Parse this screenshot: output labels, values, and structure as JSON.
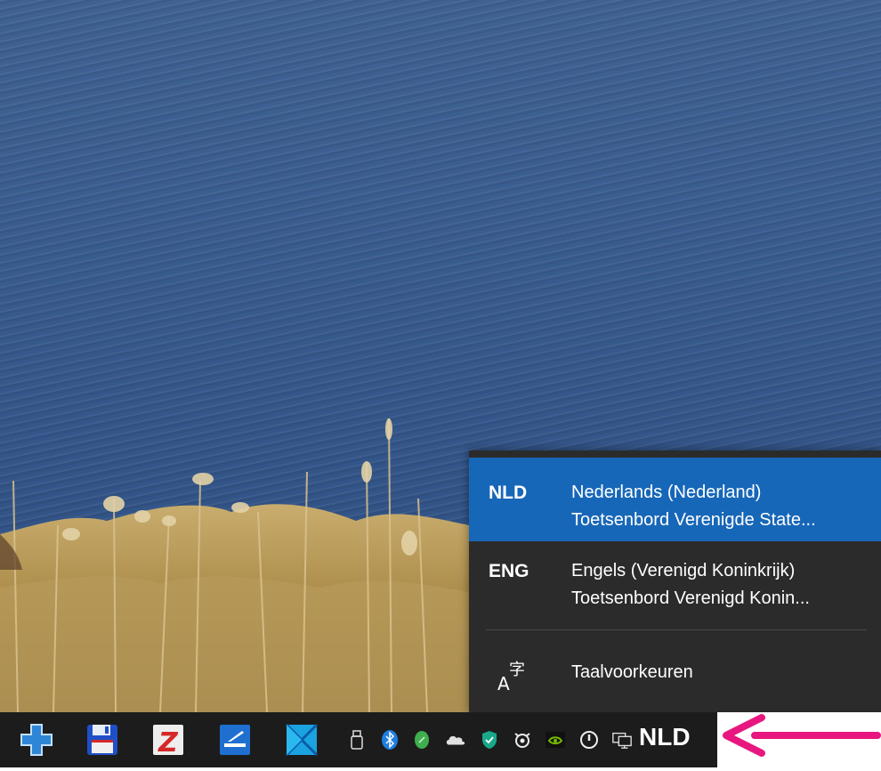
{
  "flyout": {
    "languages": [
      {
        "code": "NLD",
        "name": "Nederlands (Nederland)",
        "keyboard": "Toetsenbord Verenigde State...",
        "selected": true
      },
      {
        "code": "ENG",
        "name": "Engels (Verenigd Koninkrijk)",
        "keyboard": "Toetsenbord Verenigd Konin...",
        "selected": false
      }
    ],
    "preferences_label": "Taalvoorkeuren",
    "selected_color": "#1767b8",
    "background_color": "#2b2b2b"
  },
  "taskbar": {
    "apps": [
      {
        "icon": "medical-plus-app-icon"
      },
      {
        "icon": "floppy-disk-app-icon"
      },
      {
        "icon": "z-app-icon"
      },
      {
        "icon": "scanner-app-icon"
      },
      {
        "icon": "window-app-icon"
      }
    ],
    "tray_icons": [
      "usb-drive-icon",
      "bluetooth-icon",
      "green-shield-icon",
      "onedrive-cloud-icon",
      "security-shield-icon",
      "steelseries-icon",
      "nvidia-icon",
      "power-icon",
      "network-icon"
    ],
    "language_indicator": "NLD"
  },
  "annotation": {
    "arrow_color": "#e8177f"
  }
}
